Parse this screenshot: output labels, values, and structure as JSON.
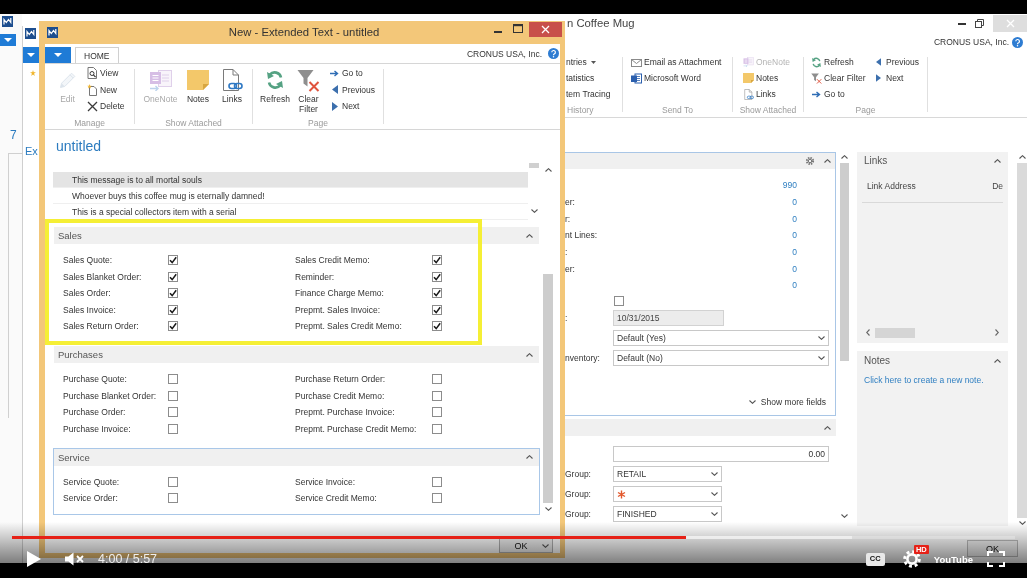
{
  "background_window": {
    "title": "n Coffee Mug",
    "company": "CRONUS USA, Inc.",
    "heading_fragment": "7",
    "ribbon_groups": [
      {
        "label": "History",
        "columns": [
          [
            {
              "label": "ntries",
              "kind": "menu",
              "disabled": false
            },
            {
              "label": "tatistics",
              "kind": "plain",
              "disabled": false
            },
            {
              "label": "tem Tracing",
              "kind": "plain",
              "disabled": false
            }
          ]
        ]
      },
      {
        "label": "Send To",
        "columns": [
          [
            {
              "label": "Email as Attachment",
              "kind": "icon",
              "disabled": false
            },
            {
              "label": "Microsoft Word",
              "kind": "icon",
              "disabled": false
            }
          ]
        ]
      },
      {
        "label": "Show Attached",
        "columns": [
          [
            {
              "label": "OneNote",
              "kind": "icon",
              "disabled": true
            },
            {
              "label": "Notes",
              "kind": "icon",
              "disabled": false
            },
            {
              "label": "Links",
              "kind": "icon",
              "disabled": false
            }
          ]
        ]
      },
      {
        "label": "Page",
        "columns": [
          [
            {
              "label": "Refresh",
              "kind": "icon",
              "disabled": false
            },
            {
              "label": "Clear Filter",
              "kind": "icon",
              "disabled": false
            },
            {
              "label": "Go to",
              "kind": "icon",
              "disabled": false
            }
          ],
          [
            {
              "label": "Previous",
              "kind": "icon",
              "disabled": false
            },
            {
              "label": "Next",
              "kind": "icon",
              "disabled": false
            }
          ]
        ]
      }
    ],
    "general_panel": {
      "expanded": true,
      "fields": [
        {
          "kind": "link",
          "value": "990"
        },
        {
          "kind": "link",
          "label": "er:",
          "value": "0"
        },
        {
          "kind": "link",
          "label": "r:",
          "value": "0"
        },
        {
          "kind": "link",
          "label": "nt Lines:",
          "value": "0"
        },
        {
          "kind": "link",
          "label": ":",
          "value": "0"
        },
        {
          "kind": "link",
          "label": "er:",
          "value": "0"
        },
        {
          "kind": "link",
          "value": "0"
        },
        {
          "kind": "checkbox",
          "checked": false
        },
        {
          "kind": "date",
          "label": ":",
          "value": "10/31/2015"
        },
        {
          "kind": "dropdown",
          "value": "Default (Yes)"
        },
        {
          "kind": "dropdown",
          "label": "nventory:",
          "value": "Default (No)"
        }
      ],
      "more_link": "Show more fields"
    },
    "second_panel": {
      "expanded": true,
      "fields": [
        {
          "kind": "number",
          "value": "0.00",
          "required": false
        },
        {
          "kind": "dropdown",
          "label": "Group:",
          "value": "RETAIL",
          "required": false
        },
        {
          "kind": "dropdown",
          "label": "Group:",
          "required": true
        },
        {
          "kind": "dropdown",
          "label": "Group:",
          "value": "FINISHED",
          "required": false
        }
      ]
    },
    "links_factbox": {
      "title": "Links",
      "expanded": true,
      "columns": [
        "Link Address",
        "De"
      ]
    },
    "notes_factbox": {
      "title": "Notes",
      "expanded": true,
      "link": "Click here to create a new note."
    },
    "ok_button": "OK"
  },
  "side_window": {
    "heading_fragment": "Ex"
  },
  "dialog": {
    "title": "New - Extended Text - untitled",
    "tabs": [
      {
        "label": "HOME",
        "selected": true
      }
    ],
    "company": "CRONUS USA, Inc.",
    "ribbon_groups": [
      {
        "label": "Manage",
        "large_actions": [
          {
            "label": "Edit",
            "disabled": true
          }
        ],
        "small_actions": [
          {
            "label": "View",
            "disabled": false
          },
          {
            "label": "New",
            "disabled": false
          },
          {
            "label": "Delete",
            "disabled": false
          }
        ]
      },
      {
        "label": "Show Attached",
        "large_actions": [
          {
            "label": "OneNote",
            "disabled": true
          },
          {
            "label": "Notes",
            "disabled": false
          },
          {
            "label": "Links",
            "disabled": false
          }
        ]
      },
      {
        "label": "Page",
        "large_actions": [
          {
            "label": "Refresh",
            "disabled": false
          },
          {
            "label": "Clear Filter",
            "disabled": false
          }
        ],
        "small_actions": [
          {
            "label": "Go to",
            "disabled": false
          },
          {
            "label": "Previous",
            "disabled": false
          },
          {
            "label": "Next",
            "disabled": false
          }
        ]
      }
    ],
    "heading": "untitled",
    "lines": [
      {
        "text": "This message is to all mortal souls",
        "selected": true
      },
      {
        "text": "Whoever buys this coffee mug is eternally damned!",
        "selected": false
      },
      {
        "text": "This is a special collectors item with a serial",
        "selected": false
      }
    ],
    "sections": [
      {
        "title": "Sales",
        "expanded": true,
        "focused": false,
        "columns": [
          [
            {
              "label": "Sales Quote:",
              "checked": true
            },
            {
              "label": "Sales Blanket Order:",
              "checked": true
            },
            {
              "label": "Sales Order:",
              "checked": true
            },
            {
              "label": "Sales Invoice:",
              "checked": true
            },
            {
              "label": "Sales Return Order:",
              "checked": true
            }
          ],
          [
            {
              "label": "Sales Credit Memo:",
              "checked": true
            },
            {
              "label": "Reminder:",
              "checked": true
            },
            {
              "label": "Finance Charge Memo:",
              "checked": true
            },
            {
              "label": "Prepmt. Sales Invoice:",
              "checked": true
            },
            {
              "label": "Prepmt. Sales Credit Memo:",
              "checked": true
            }
          ]
        ]
      },
      {
        "title": "Purchases",
        "expanded": true,
        "focused": false,
        "columns": [
          [
            {
              "label": "Purchase Quote:",
              "checked": false
            },
            {
              "label": "Purchase Blanket Order:",
              "checked": false
            },
            {
              "label": "Purchase Order:",
              "checked": false
            },
            {
              "label": "Purchase Invoice:",
              "checked": false
            }
          ],
          [
            {
              "label": "Purchase Return Order:",
              "checked": false
            },
            {
              "label": "Purchase Credit Memo:",
              "checked": false
            },
            {
              "label": "Prepmt. Purchase Invoice:",
              "checked": false
            },
            {
              "label": "Prepmt. Purchase Credit Memo:",
              "checked": false
            }
          ]
        ]
      },
      {
        "title": "Service",
        "expanded": true,
        "focused": true,
        "columns": [
          [
            {
              "label": "Service Quote:",
              "checked": false
            },
            {
              "label": "Service Order:",
              "checked": false
            }
          ],
          [
            {
              "label": "Service Invoice:",
              "checked": false
            },
            {
              "label": "Service Credit Memo:",
              "checked": false
            }
          ]
        ]
      }
    ],
    "ok_button": "OK"
  },
  "player": {
    "playing": false,
    "muted": true,
    "progress": {
      "level": 0.672
    },
    "buffer": {
      "level": 0.837
    },
    "time": "4:00 / 5:57",
    "captions_button": "CC",
    "hd_badge": "HD",
    "logo": "YouTube"
  }
}
